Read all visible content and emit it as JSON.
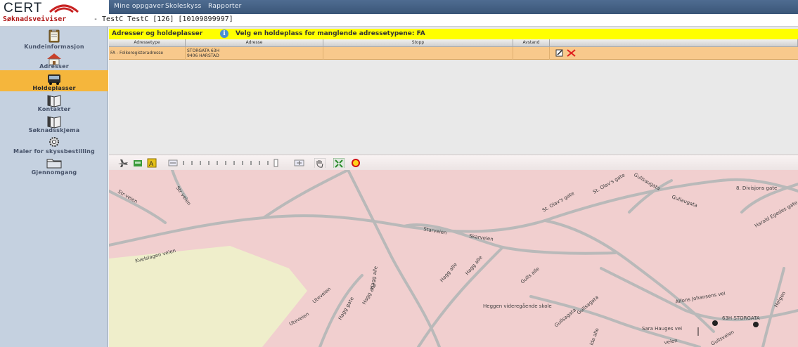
{
  "brand": {
    "logo_text": "CERT"
  },
  "top_menu": {
    "items": [
      "Mine oppgaver",
      "Skoleskyss",
      "Rapporter"
    ]
  },
  "sub_header": {
    "app_name": "Søknadsveiviser",
    "customer": "- TestC TestC [126] [10109899997]"
  },
  "sidebar": {
    "items": [
      {
        "label": "Kundeinformasjon",
        "icon": "clipboard-icon"
      },
      {
        "label": "Adresser",
        "icon": "house-icon"
      },
      {
        "label": "Holdeplasser",
        "icon": "bus-icon",
        "active": true
      },
      {
        "label": "Kontakter",
        "icon": "book-icon"
      },
      {
        "label": "Søknadsskjema",
        "icon": "book-icon"
      },
      {
        "label": "Maler for skyssbestilling",
        "icon": "gear-icon"
      },
      {
        "label": "Gjennomgang",
        "icon": "folder-icon"
      }
    ]
  },
  "content": {
    "title": "Adresser og holdeplasser",
    "info_icon_text": "i",
    "message": "Velg en holdeplass for manglende adressetypene: FA",
    "columns": [
      "Adressetype",
      "Adresse",
      "Stopp",
      "Avstand"
    ],
    "rows": [
      {
        "type": "FA - Folkeregisteradresse",
        "address_line1": "STORGATA 63H",
        "address_line2": "9406 HARSTAD",
        "stop": "",
        "distance": ""
      }
    ]
  },
  "map": {
    "labels": [
      "Str-veien",
      "Str veien",
      "Kvelslagen veien",
      "Starveien",
      "Skarveien",
      "St. Olav's gate",
      "St. Olav's gate",
      "Gullsaugata",
      "Gullaugata",
      "8. Divisjons gate",
      "Harald Egedes gate",
      "Hagg alle",
      "Hagg alle",
      "Hagg alle",
      "Gulls alle",
      "Uteveien",
      "Uteveien",
      "Hagg gate",
      "Hagg alle",
      "Heggen videregående skole",
      "Alfons Johansens vei",
      "63H STORGATA",
      "Sara Hauges vei",
      "Gullsagata",
      "Gullsagata",
      "Ida alle",
      "Gullsveien",
      "Helgen",
      "veien"
    ]
  },
  "colors": {
    "top_menu_bg": "#3f5a7d",
    "sidebar_bg": "#c5d1e0",
    "active_item": "#f5b63c",
    "title_bar": "#ffff00",
    "selected_row": "#f8c98c",
    "map_bg": "#f1cfcf",
    "map_green": "#efeecb",
    "road": "#b9b9b9",
    "app_name": "#b01818"
  }
}
